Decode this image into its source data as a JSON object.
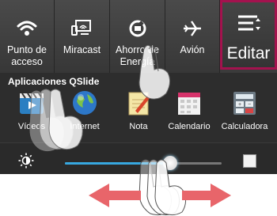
{
  "quick_settings": {
    "items": [
      {
        "label": "Punto de acceso",
        "icon": "wifi-hotspot-icon"
      },
      {
        "label": "Miracast",
        "icon": "miracast-icon"
      },
      {
        "label": "Ahorro de Energía",
        "icon": "battery-saver-icon"
      },
      {
        "label": "Avión",
        "icon": "airplane-icon"
      }
    ],
    "edit": {
      "label": "Editar",
      "icon": "edit-list-icon",
      "accent_color": "#a4124e"
    }
  },
  "qslide": {
    "title": "Aplicaciones QSlide",
    "apps": [
      {
        "label": "Vídeos",
        "icon": "video-icon"
      },
      {
        "label": "Internet",
        "icon": "globe-icon"
      },
      {
        "label": "Nota",
        "icon": "note-icon"
      },
      {
        "label": "Calendario",
        "icon": "calendar-icon"
      },
      {
        "label": "Calculadora",
        "icon": "calculator-icon"
      }
    ]
  },
  "brightness": {
    "level": 0.67,
    "icon": "brightness-icon",
    "fill_color": "#37a8e0",
    "auto_checked": false
  },
  "gesture": {
    "arrow_color": "#e8656a",
    "direction": "left-right swipe"
  }
}
